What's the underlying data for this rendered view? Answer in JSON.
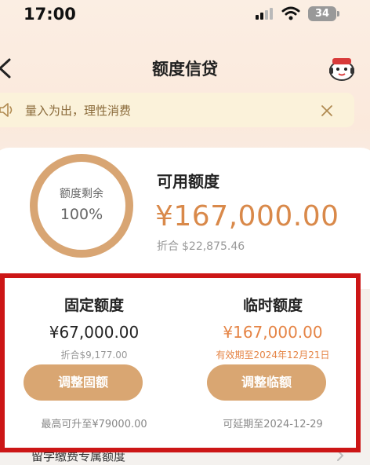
{
  "status_bar": {
    "time": "17:00",
    "battery": "34"
  },
  "nav": {
    "title": "额度信贷"
  },
  "tip": {
    "text": "量入为出，理性消费"
  },
  "summary": {
    "ring_label": "额度剩余",
    "ring_value": "100%",
    "ring_fraction": 1.0,
    "available_title": "可用额度",
    "available_amount": "¥167,000.00",
    "equiv_label": "折合",
    "equiv_value": "$22,875.46"
  },
  "fixed_quota": {
    "title": "固定额度",
    "amount": "¥67,000.00",
    "sub": "折合$9,177.00",
    "button": "调整固额",
    "note": "最高可升至¥79000.00"
  },
  "temp_quota": {
    "title": "临时额度",
    "amount": "¥167,000.00",
    "sub": "有效期至2024年12月21日",
    "button": "调整临额",
    "note": "可延期至2024-12-29"
  },
  "bottom": {
    "label": "留学缴费专属额度"
  },
  "colors": {
    "accent": "#d9a672",
    "amount": "#d9894a",
    "highlight_border": "#cc1616"
  }
}
